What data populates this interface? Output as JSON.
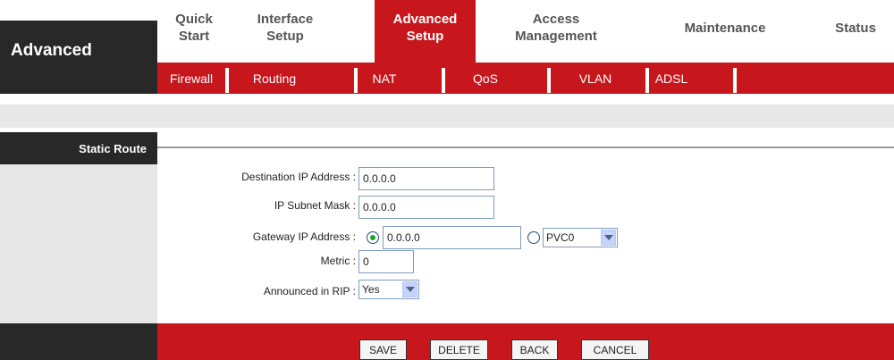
{
  "brand": {
    "title": "Advanced"
  },
  "main_nav": [
    {
      "label": "Quick Start",
      "active": false
    },
    {
      "label": "Interface Setup",
      "active": false
    },
    {
      "label": "Advanced Setup",
      "active": true
    },
    {
      "label": "Access Management",
      "active": false
    },
    {
      "label": "Maintenance",
      "active": false
    },
    {
      "label": "Status",
      "active": false
    }
  ],
  "sub_nav": [
    {
      "label": "Firewall"
    },
    {
      "label": "Routing"
    },
    {
      "label": "NAT"
    },
    {
      "label": "QoS"
    },
    {
      "label": "VLAN"
    },
    {
      "label": "ADSL"
    }
  ],
  "section": {
    "title": "Static Route"
  },
  "form": {
    "destination_label": "Destination IP Address :",
    "destination_value": "0.0.0.0",
    "subnet_label": "IP Subnet Mask :",
    "subnet_value": "0.0.0.0",
    "gateway_label": "Gateway IP Address :",
    "gateway_value": "0.0.0.0",
    "gateway_mode": "ip",
    "pvc_selected": "PVC0",
    "metric_label": "Metric :",
    "metric_value": "0",
    "rip_label": "Announced in RIP :",
    "rip_selected": "Yes"
  },
  "buttons": {
    "save": "SAVE",
    "delete": "DELETE",
    "back": "BACK",
    "cancel": "CANCEL"
  },
  "colors": {
    "accent_red": "#c8161d",
    "dark": "#282828",
    "panel_grey": "#e7e7e7"
  }
}
